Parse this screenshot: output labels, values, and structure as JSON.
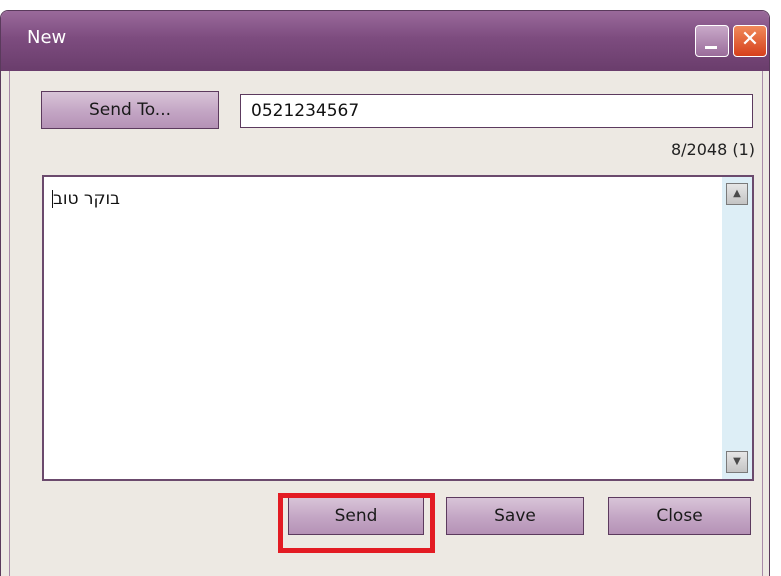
{
  "window": {
    "title": "New"
  },
  "title_controls": {
    "minimize": "_",
    "close": "✕"
  },
  "send_to": {
    "label": "Send To...",
    "value": "0521234567"
  },
  "counter": "8/2048 (1)",
  "message": {
    "text": "בוקר טוב"
  },
  "scrollbar": {
    "up": "▲",
    "down": "▼"
  },
  "buttons": {
    "send": "Send",
    "save": "Save",
    "close": "Close"
  },
  "highlight_color": "#e31b23"
}
